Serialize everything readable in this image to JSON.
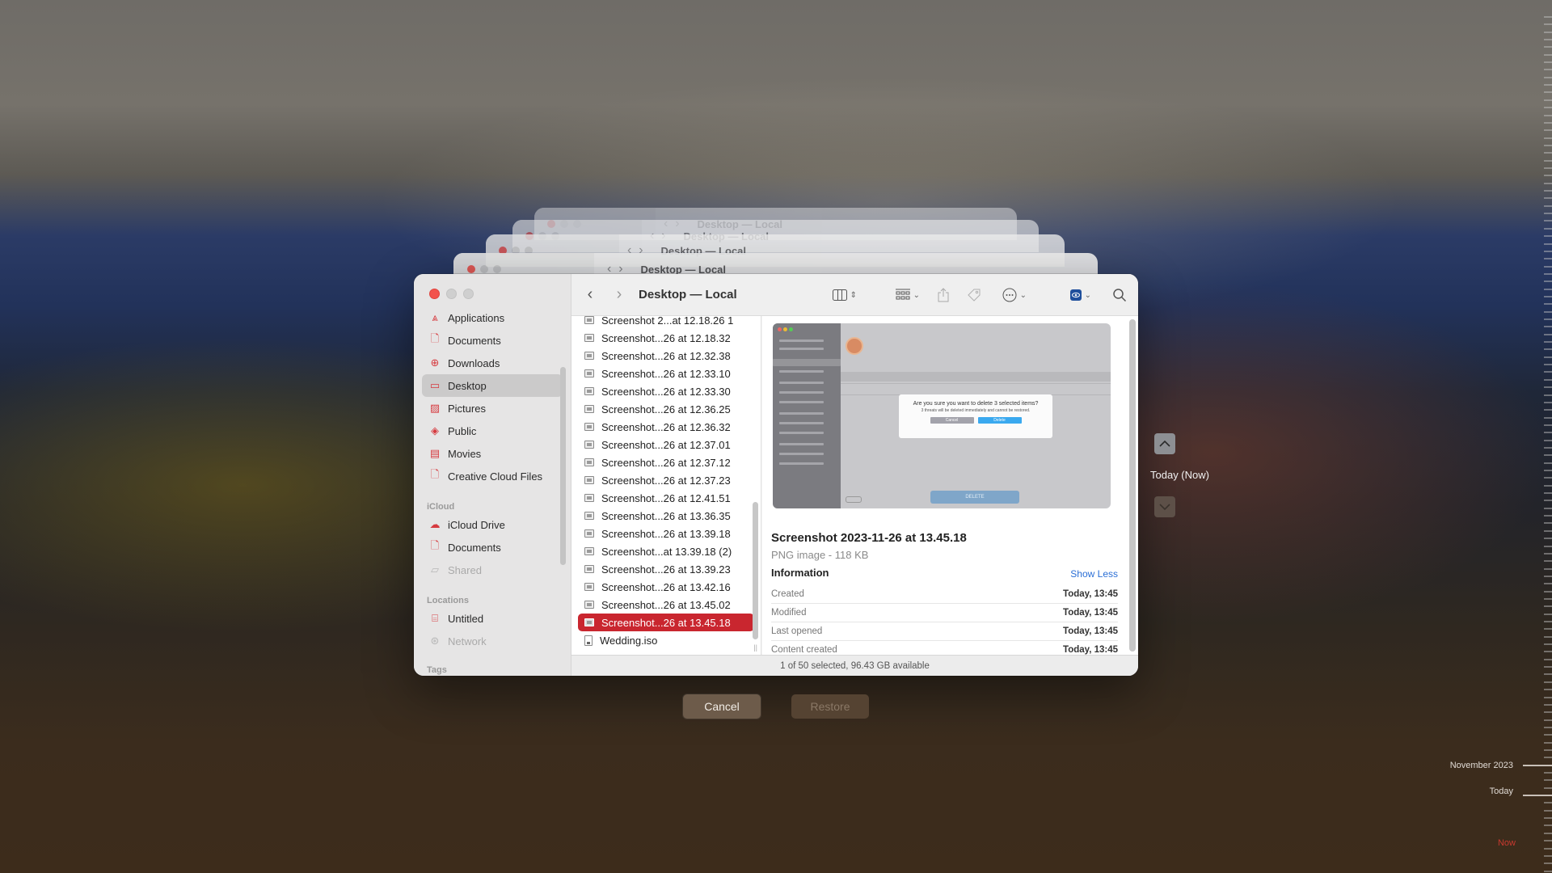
{
  "window": {
    "title": "Desktop — Local",
    "back_window_titles": [
      "Desktop — Local",
      "Desktop — Local",
      "Desktop — Local",
      "Desktop — Local"
    ]
  },
  "toolbar": {
    "back_icon": "chevron-left-icon",
    "forward_icon": "chevron-right-icon",
    "view_icon": "columns-view-icon",
    "group_icon": "grid-group-icon",
    "share_icon": "share-icon",
    "tag_icon": "tag-icon",
    "more_icon": "ellipsis-circle-icon",
    "quicklook_icon": "eye-icon",
    "search_icon": "magnifier-icon"
  },
  "sidebar": {
    "favorites": [
      {
        "label": "Applications",
        "icon": "applications-icon",
        "glyph": "⩓"
      },
      {
        "label": "Documents",
        "icon": "document-icon",
        "glyph": "🗋"
      },
      {
        "label": "Downloads",
        "icon": "download-icon",
        "glyph": "⊕"
      },
      {
        "label": "Desktop",
        "icon": "desktop-icon",
        "glyph": "▭",
        "selected": true
      },
      {
        "label": "Pictures",
        "icon": "pictures-icon",
        "glyph": "▨"
      },
      {
        "label": "Public",
        "icon": "public-icon",
        "glyph": "◈"
      },
      {
        "label": "Movies",
        "icon": "movies-icon",
        "glyph": "▤"
      },
      {
        "label": "Creative Cloud Files",
        "icon": "file-icon",
        "glyph": "🗋"
      }
    ],
    "icloud_header": "iCloud",
    "icloud": [
      {
        "label": "iCloud Drive",
        "icon": "cloud-icon",
        "glyph": "☁"
      },
      {
        "label": "Documents",
        "icon": "document-icon",
        "glyph": "🗋"
      },
      {
        "label": "Shared",
        "icon": "shared-folder-icon",
        "glyph": "▱",
        "dim": true
      }
    ],
    "locations_header": "Locations",
    "locations": [
      {
        "label": "Untitled",
        "icon": "disk-icon",
        "glyph": "⌸"
      },
      {
        "label": "Network",
        "icon": "network-globe-icon",
        "glyph": "⊛",
        "dim": true
      }
    ],
    "tags_header": "Tags"
  },
  "files": [
    {
      "name": "Screenshot 2...at 12.18.26 1"
    },
    {
      "name": "Screenshot...26 at 12.18.32"
    },
    {
      "name": "Screenshot...26 at 12.32.38"
    },
    {
      "name": "Screenshot...26 at 12.33.10"
    },
    {
      "name": "Screenshot...26 at 12.33.30"
    },
    {
      "name": "Screenshot...26 at 12.36.25"
    },
    {
      "name": "Screenshot...26 at 12.36.32"
    },
    {
      "name": "Screenshot...26 at 12.37.01"
    },
    {
      "name": "Screenshot...26 at 12.37.12"
    },
    {
      "name": "Screenshot...26 at 12.37.23"
    },
    {
      "name": "Screenshot...26 at 12.41.51"
    },
    {
      "name": "Screenshot...26 at 13.36.35"
    },
    {
      "name": "Screenshot...26 at 13.39.18"
    },
    {
      "name": "Screenshot...at 13.39.18 (2)"
    },
    {
      "name": "Screenshot...26 at 13.39.23"
    },
    {
      "name": "Screenshot...26 at 13.42.16"
    },
    {
      "name": "Screenshot...26 at 13.45.02"
    },
    {
      "name": "Screenshot...26 at 13.45.18",
      "selected": true
    },
    {
      "name": "Wedding.iso",
      "type": "doc"
    }
  ],
  "preview": {
    "thumbnail": {
      "dialog_title": "Are you sure you want to delete 3 selected items?",
      "dialog_text": "3 threats will be deleted immediately and cannot be restored.",
      "dialog_cancel": "Cancel",
      "dialog_delete": "Delete",
      "delete_button": "DELETE",
      "accent": "#3aa9ef"
    },
    "name": "Screenshot 2023-11-26 at 13.45.18",
    "kind": "PNG image - 118 KB",
    "info_header": "Information",
    "show_less": "Show Less",
    "info": [
      {
        "key": "Created",
        "value": "Today, 13:45"
      },
      {
        "key": "Modified",
        "value": "Today, 13:45"
      },
      {
        "key": "Last opened",
        "value": "Today, 13:45"
      },
      {
        "key": "Content created",
        "value": "Today, 13:45"
      }
    ]
  },
  "status": "1 of 50 selected, 96.43 GB available",
  "time_machine": {
    "cancel_label": "Cancel",
    "restore_label": "Restore",
    "current_label": "Today (Now)",
    "up_icon": "chevron-up-icon",
    "down_icon": "chevron-down-icon",
    "timeline": {
      "labels": [
        "November 2023",
        "Today",
        "Now"
      ],
      "now_color": "#d43a35"
    }
  },
  "colors": {
    "selection": "#c9262f",
    "sidebar_icon": "#d63a3f",
    "link": "#2b6fd6"
  }
}
